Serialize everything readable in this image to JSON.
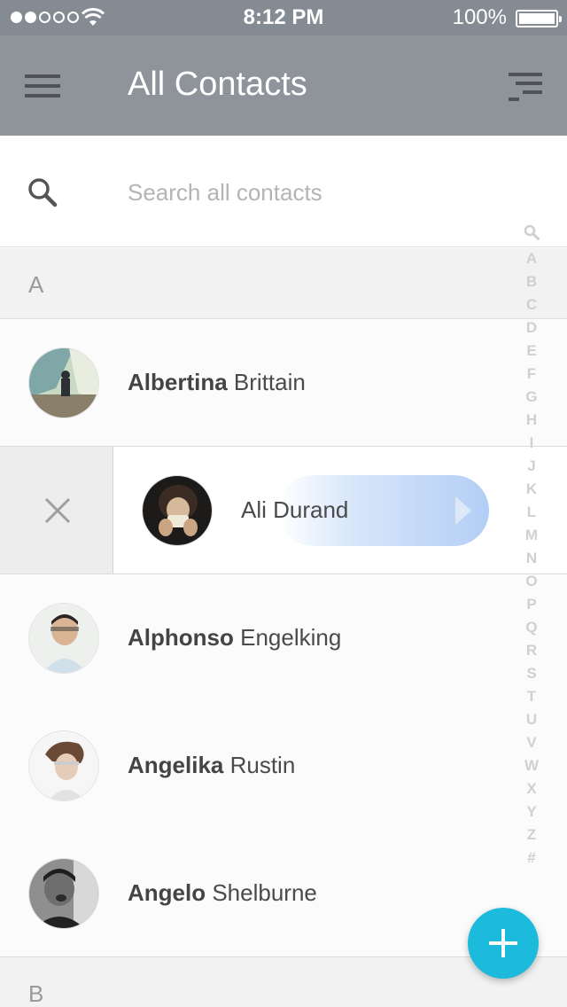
{
  "status_bar": {
    "time": "8:12 PM",
    "battery": "100%",
    "signal_dots_filled": 2,
    "signal_dots_total": 5
  },
  "nav": {
    "title": "All Contacts",
    "menu_icon": "hamburger-menu-icon",
    "sort_icon": "sort-lines-icon"
  },
  "search": {
    "placeholder": "Search all contacts",
    "value": ""
  },
  "sections": [
    {
      "letter": "A"
    },
    {
      "letter": "B"
    }
  ],
  "contacts": [
    {
      "first": "Albertina",
      "last": " Brittain"
    },
    {
      "first": "Ali",
      "last": "Durand",
      "full": "Ali Durand",
      "swiped": true
    },
    {
      "first": "Alphonso",
      "last": " Engelking"
    },
    {
      "first": "Angelika",
      "last": " Rustin"
    },
    {
      "first": "Angelo",
      "last": " Shelburne"
    }
  ],
  "index_letters": [
    "A",
    "B",
    "C",
    "D",
    "E",
    "F",
    "G",
    "H",
    "I",
    "J",
    "K",
    "L",
    "M",
    "N",
    "O",
    "P",
    "Q",
    "R",
    "S",
    "T",
    "U",
    "V",
    "W",
    "X",
    "Y",
    "Z",
    "#"
  ],
  "colors": {
    "status_bar": "#858b92",
    "nav_bar": "#8e949a",
    "fab": "#1cbadb",
    "section_bg": "#f2f2f2",
    "swipe_highlight": "#b3cef5"
  }
}
